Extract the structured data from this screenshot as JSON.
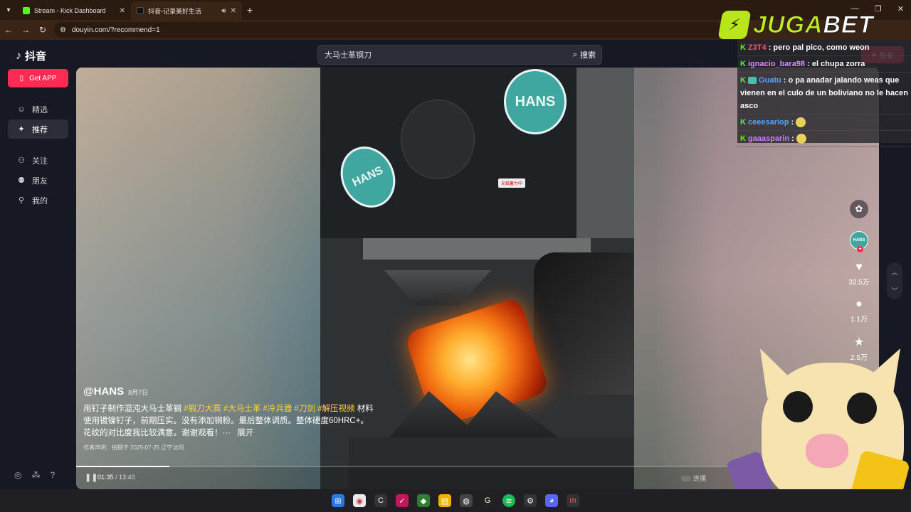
{
  "browser": {
    "tabs": [
      {
        "title": "Stream - Kick Dashboard",
        "active": false
      },
      {
        "title": "抖音-记录美好生活",
        "active": true
      }
    ],
    "url": "douyin.com/?recommend=1"
  },
  "app": {
    "logo": "抖音",
    "get_app": "Get APP",
    "nav": [
      "精选",
      "推荐",
      "关注",
      "朋友",
      "我的"
    ],
    "search_value": "大马士革钢刀",
    "search_button": "搜索",
    "login": "登录"
  },
  "video": {
    "author": "@HANS",
    "date": "8月7日",
    "desc_plain": "用钉子制作混沌大马士革钢 ",
    "tags": [
      "#锻刀大赛",
      "#大马士革",
      "#冷兵器",
      "#刀剑",
      "#解压视频"
    ],
    "desc_rest": "材料使用镀镍钉子，前期压实。没有添加钢粉。最后整体调质。整体硬度60HRC+。花纹的对比度我比较满意。谢谢观看！···",
    "expand": "展开",
    "note": "作者声明：拍摄于 2025-07-25 辽宁沈阳",
    "time_current": "01:35",
    "time_total": "13:40",
    "progress": 0.116,
    "autoplay_label": "连播",
    "sticker_text": "HANS",
    "device_label": "光纸蓄力中"
  },
  "actions": {
    "avatar_text": "HANS",
    "likes": "32.5万",
    "comments": "1.1万",
    "favorites": "2.5万"
  },
  "overlay": {
    "brand_a": "JUGA",
    "brand_b": "BET",
    "chat": [
      {
        "user": "Z3T4",
        "msg": "pero pal pico, como weon"
      },
      {
        "user": "ignacio_bara98",
        "msg": "el chupa zorra"
      },
      {
        "user": "Guatu",
        "msg": "o pa anadar jalando weas que vienen en el culo de un boliviano no le hacen asco"
      },
      {
        "user": "ceeesariop",
        "msg": ""
      },
      {
        "user": "gaaasparin",
        "msg": ""
      }
    ]
  },
  "colors": {
    "accent": "#fe2c55",
    "tag": "#ffd43b",
    "kick": "#53fc18",
    "brand": "#c3ec1f"
  }
}
